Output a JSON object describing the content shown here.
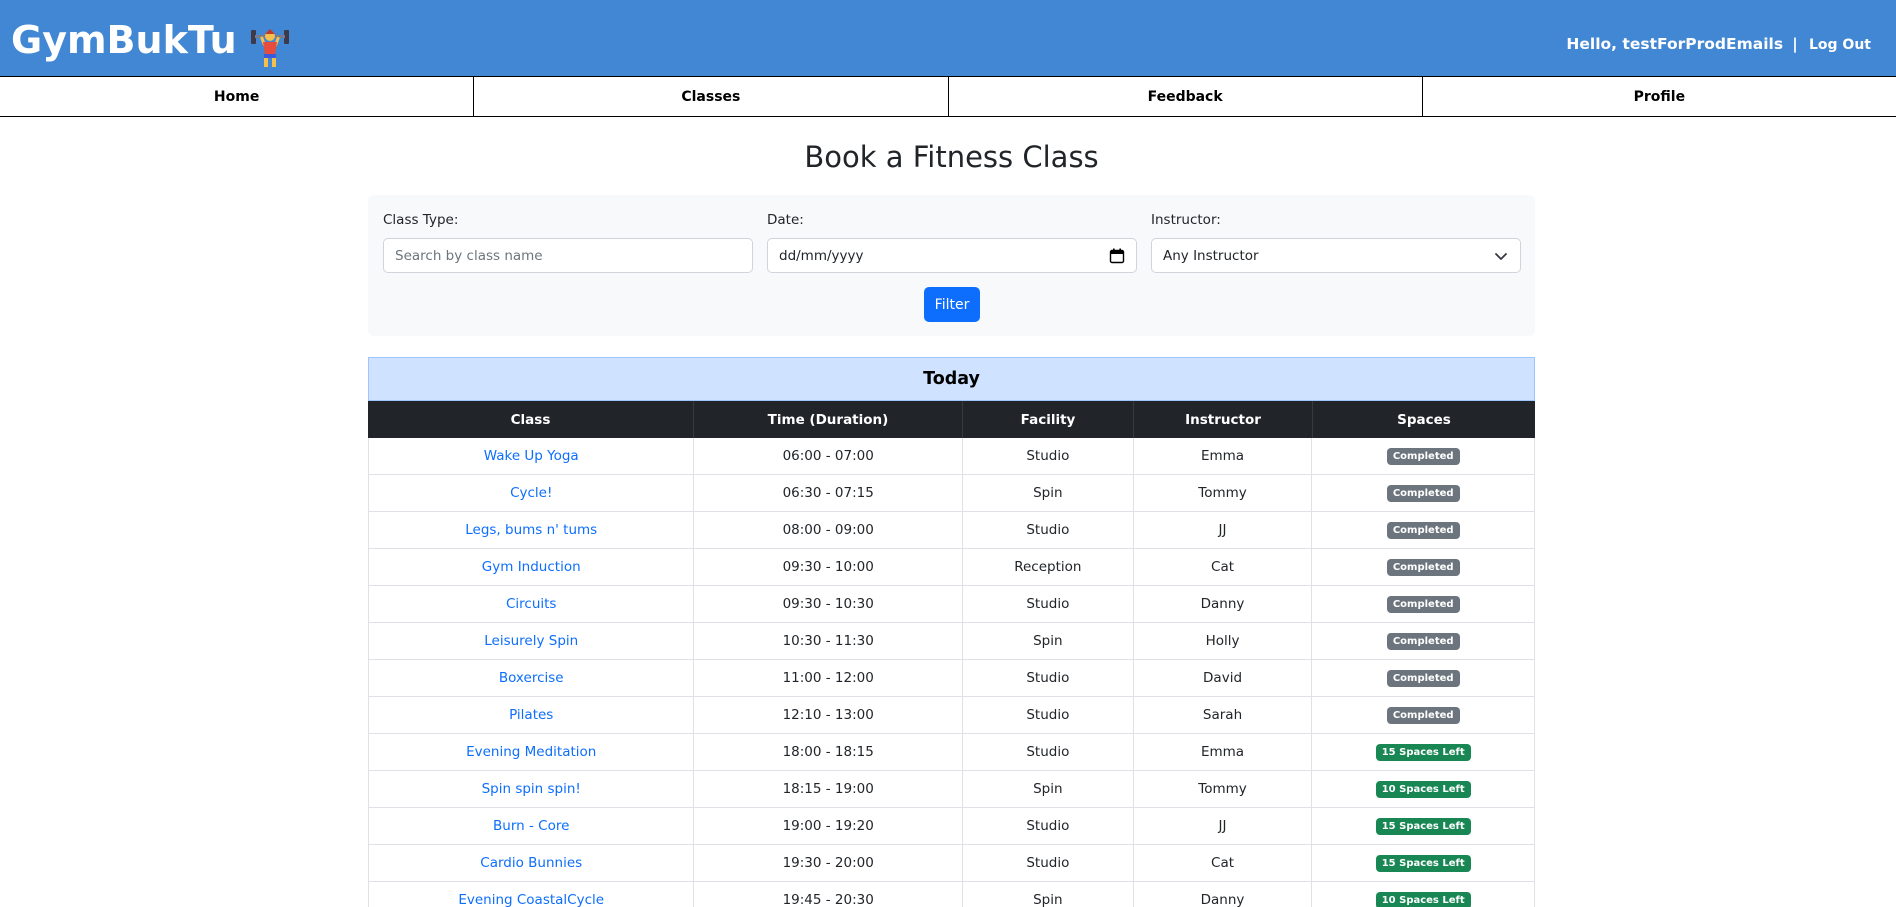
{
  "header": {
    "brand": "GymBukTu",
    "greeting": "Hello, testForProdEmails",
    "separator": "|",
    "logout_label": "Log Out",
    "bg_color": "#4287d3"
  },
  "nav": {
    "items": [
      {
        "label": "Home"
      },
      {
        "label": "Classes"
      },
      {
        "label": "Feedback"
      },
      {
        "label": "Profile"
      }
    ]
  },
  "page": {
    "title": "Book a Fitness Class"
  },
  "filters": {
    "class_type": {
      "label": "Class Type:",
      "placeholder": "Search by class name",
      "value": ""
    },
    "date": {
      "label": "Date:",
      "value": "dd/mm/yyyy"
    },
    "instructor": {
      "label": "Instructor:",
      "selected": "Any Instructor"
    },
    "filter_label": "Filter"
  },
  "schedule": {
    "day_title": "Today",
    "columns": [
      "Class",
      "Time (Duration)",
      "Facility",
      "Instructor",
      "Spaces"
    ],
    "rows": [
      {
        "class": "Wake Up Yoga",
        "time": "06:00 - 07:00",
        "facility": "Studio",
        "instructor": "Emma",
        "spaces": "Completed",
        "status": "completed"
      },
      {
        "class": "Cycle!",
        "time": "06:30 - 07:15",
        "facility": "Spin",
        "instructor": "Tommy",
        "spaces": "Completed",
        "status": "completed"
      },
      {
        "class": "Legs, bums n' tums",
        "time": "08:00 - 09:00",
        "facility": "Studio",
        "instructor": "JJ",
        "spaces": "Completed",
        "status": "completed"
      },
      {
        "class": "Gym Induction",
        "time": "09:30 - 10:00",
        "facility": "Reception",
        "instructor": "Cat",
        "spaces": "Completed",
        "status": "completed"
      },
      {
        "class": "Circuits",
        "time": "09:30 - 10:30",
        "facility": "Studio",
        "instructor": "Danny",
        "spaces": "Completed",
        "status": "completed"
      },
      {
        "class": "Leisurely Spin",
        "time": "10:30 - 11:30",
        "facility": "Spin",
        "instructor": "Holly",
        "spaces": "Completed",
        "status": "completed"
      },
      {
        "class": "Boxercise",
        "time": "11:00 - 12:00",
        "facility": "Studio",
        "instructor": "David",
        "spaces": "Completed",
        "status": "completed"
      },
      {
        "class": "Pilates",
        "time": "12:10 - 13:00",
        "facility": "Studio",
        "instructor": "Sarah",
        "spaces": "Completed",
        "status": "completed"
      },
      {
        "class": "Evening Meditation",
        "time": "18:00 - 18:15",
        "facility": "Studio",
        "instructor": "Emma",
        "spaces": "15 Spaces Left",
        "status": "available"
      },
      {
        "class": "Spin spin spin!",
        "time": "18:15 - 19:00",
        "facility": "Spin",
        "instructor": "Tommy",
        "spaces": "10 Spaces Left",
        "status": "available"
      },
      {
        "class": "Burn - Core",
        "time": "19:00 - 19:20",
        "facility": "Studio",
        "instructor": "JJ",
        "spaces": "15 Spaces Left",
        "status": "available"
      },
      {
        "class": "Cardio Bunnies",
        "time": "19:30 - 20:00",
        "facility": "Studio",
        "instructor": "Cat",
        "spaces": "15 Spaces Left",
        "status": "available"
      },
      {
        "class": "Evening CoastalCycle",
        "time": "19:45 - 20:30",
        "facility": "Spin",
        "instructor": "Danny",
        "spaces": "10 Spaces Left",
        "status": "available"
      }
    ]
  },
  "colors": {
    "link": "#0d6efd",
    "completed_badge": "#6c757d",
    "available_badge": "#198754",
    "day_header_bg": "#cfe2ff",
    "table_header_bg": "#212529"
  }
}
